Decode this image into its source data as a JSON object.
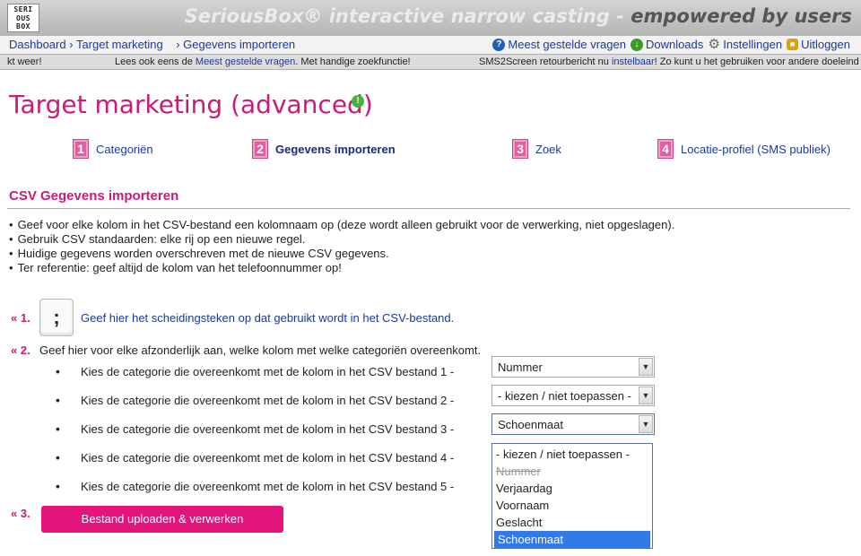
{
  "header": {
    "logo_lines": [
      "SERI",
      "OUS",
      "BOX"
    ],
    "title_light": "SeriousBox® interactive narrow casting - ",
    "title_accent": "empowered by users"
  },
  "nav": {
    "breadcrumbs": [
      "Dashboard",
      "Target marketing",
      "Gegevens importeren"
    ],
    "links": {
      "faq": "Meest gestelde vragen",
      "downloads": "Downloads",
      "settings": "Instellingen",
      "logout": "Uitloggen"
    }
  },
  "ticker": {
    "part1": "kt weer!",
    "part2_pre": "Lees ook eens de ",
    "part2_link": "Meest gestelde vragen",
    "part2_post": ". Met handige zoekfunctie!",
    "part3_pre": "SMS2Screen retourbericht nu ",
    "part3_link": "instelbaar",
    "part3_post": "! Zo kunt u het gebruiken voor andere doeleind"
  },
  "page_title": "Target marketing (advanced)",
  "steps": [
    {
      "num": "1",
      "label": "Categoriën"
    },
    {
      "num": "2",
      "label": "Gegevens importeren"
    },
    {
      "num": "3",
      "label": "Zoek"
    },
    {
      "num": "4",
      "label": "Locatie-profiel (SMS publiek)"
    }
  ],
  "section": {
    "title": "CSV Gegevens importeren",
    "info": [
      "Geef voor elke kolom in het CSV-bestand een kolomnaam op (deze wordt alleen gebruikt voor de verwerking, niet opgeslagen).",
      "Gebruik CSV standaarden: elke rij op een nieuwe regel.",
      "Huidige gegevens worden overschreven met de nieuwe CSV gegevens.",
      "Ter referentie: geef altijd de kolom van het telefoonnummer op!"
    ]
  },
  "form": {
    "step1_marker": "« 1.",
    "separator_value": ";",
    "step1_text": "Geef hier het scheidingsteken op dat gebruikt wordt in het CSV-bestand.",
    "step2_marker": "« 2.",
    "step2_text": "Geef hier voor elke afzonderlijk aan, welke kolom met welke categoriën overeenkomt.",
    "rows": [
      {
        "label": "Kies de categorie die overeenkomt met de kolom in het CSV bestand 1 -",
        "value": "Nummer"
      },
      {
        "label": "Kies de categorie die overeenkomt met de kolom in het CSV bestand 2 -",
        "value": "- kiezen / niet toepassen -"
      },
      {
        "label": "Kies de categorie die overeenkomt met de kolom in het CSV bestand 3 -",
        "value": "Schoenmaat"
      },
      {
        "label": "Kies de categorie die overeenkomt met de kolom in het CSV bestand 4 -",
        "value": ""
      },
      {
        "label": "Kies de categorie die overeenkomt met de kolom in het CSV bestand 5 -",
        "value": ""
      }
    ],
    "dropdown_options": [
      "- kiezen / niet toepassen -",
      "Nummer",
      "Verjaardag",
      "Voornaam",
      "Geslacht",
      "Schoenmaat"
    ],
    "step3_marker": "« 3.",
    "upload_label": "Bestand uploaden & verwerken"
  }
}
